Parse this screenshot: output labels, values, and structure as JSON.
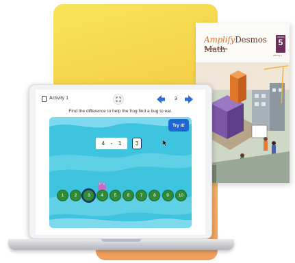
{
  "book": {
    "brand": "Amplify",
    "title_rest": "Desmos Math",
    "edition": "Teacher Edition",
    "grade_label": "GRADE",
    "grade_number": "5",
    "volume": "Volume 2"
  },
  "activity": {
    "label": "Activity 1",
    "page": "3",
    "instruction": "Find the difference to help the frog find a bug to eat.",
    "try_button": "Try it!",
    "equation": {
      "left": "4",
      "operator": "-",
      "right": "1",
      "answer": "3"
    },
    "pads": [
      "1",
      "2",
      "3",
      "4",
      "5",
      "6",
      "7",
      "8",
      "9",
      "10"
    ],
    "selected_pad": "3"
  },
  "colors": {
    "yellow_panel": "#f6d24a",
    "orange_panel": "#f29e5c",
    "water": "#3fc4df",
    "nav_arrow": "#2a6fd6",
    "try_button": "#1f66d1",
    "lily_pad": "#2f8a3a",
    "frog": "#c86bc7"
  },
  "icons": {
    "activity": "document-icon",
    "center": "expand-icon",
    "prev": "arrow-left-icon",
    "next": "arrow-right-icon",
    "pointer": "mouse-pointer-icon"
  }
}
